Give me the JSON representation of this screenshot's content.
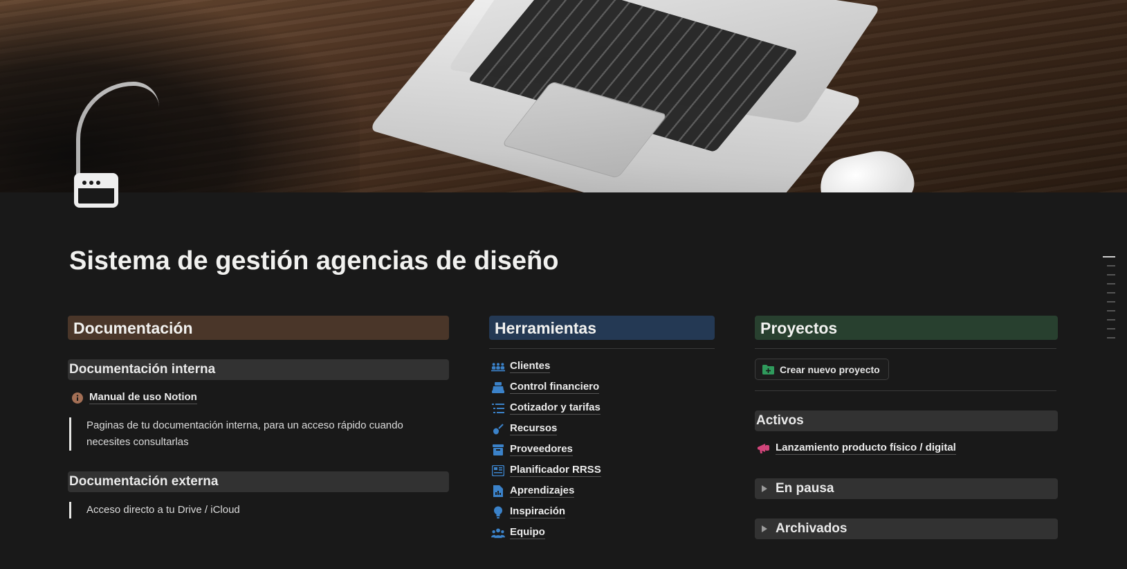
{
  "page": {
    "title": "Sistema de gestión agencias de diseño",
    "icon": "browser-window-icon"
  },
  "documentacion": {
    "heading": "Documentación",
    "interna": {
      "heading": "Documentación interna",
      "manual_link": "Manual de uso Notion",
      "manual_icon": "info-circle-icon",
      "quote": "Paginas de tu documentación interna, para un acceso rápido cuando necesites consultarlas"
    },
    "externa": {
      "heading": "Documentación externa",
      "quote": "Acceso directo a tu Drive / iCloud"
    }
  },
  "herramientas": {
    "heading": "Herramientas",
    "items": [
      {
        "label": "Clientes",
        "icon": "people-line-icon"
      },
      {
        "label": "Control financiero",
        "icon": "cash-register-icon"
      },
      {
        "label": "Cotizador y tarifas",
        "icon": "list-icon"
      },
      {
        "label": "Recursos",
        "icon": "guitar-icon"
      },
      {
        "label": "Proveedores",
        "icon": "archive-box-icon"
      },
      {
        "label": "Planificador RRSS",
        "icon": "newspaper-icon"
      },
      {
        "label": "Aprendizajes",
        "icon": "document-chart-icon"
      },
      {
        "label": "Inspiración",
        "icon": "lightbulb-icon"
      },
      {
        "label": "Equipo",
        "icon": "group-icon"
      }
    ]
  },
  "proyectos": {
    "heading": "Proyectos",
    "new_button": "Crear nuevo proyecto",
    "activos": {
      "heading": "Activos",
      "items": [
        {
          "label": "Lanzamiento producto físico / digital",
          "icon": "megaphone-icon"
        }
      ]
    },
    "en_pausa": "En pausa",
    "archivados": "Archivados"
  },
  "colors": {
    "background": "#191919",
    "documentacion_bg": "#4a3629",
    "herramientas_bg": "#243954",
    "proyectos_bg": "#28402f",
    "icon_blue": "#3b82c9",
    "icon_green": "#2f9a5c",
    "icon_pink": "#d1457a",
    "icon_brown": "#a36f55"
  }
}
